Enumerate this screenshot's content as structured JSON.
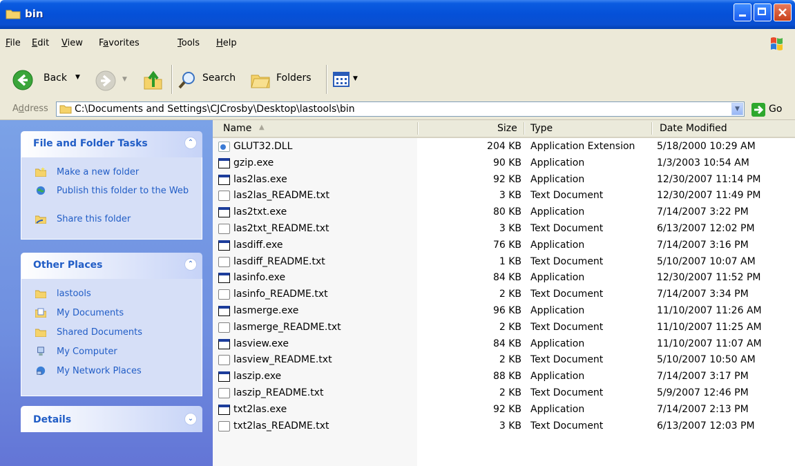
{
  "window": {
    "title": "bin",
    "controls": {
      "minimize": "minimize",
      "maximize": "maximize",
      "close": "close"
    }
  },
  "menu": [
    {
      "label": "File",
      "accel": "F",
      "rest": "ile"
    },
    {
      "label": "Edit",
      "accel": "E",
      "rest": "dit"
    },
    {
      "label": "View",
      "accel": "V",
      "rest": "iew"
    },
    {
      "label": "Favorites",
      "accel": "a",
      "pre": "F",
      "rest": "vorites"
    },
    {
      "label": "Tools",
      "accel": "T",
      "rest": "ools"
    },
    {
      "label": "Help",
      "accel": "H",
      "rest": "elp"
    }
  ],
  "toolbar": {
    "back": "Back",
    "search": "Search",
    "folders": "Folders"
  },
  "address": {
    "label_pre": "A",
    "label_accel": "d",
    "label_rest": "dress",
    "path": "C:\\Documents and Settings\\CJCrosby\\Desktop\\lastools\\bin",
    "go": "Go"
  },
  "sidebar": {
    "file_tasks": {
      "title": "File and Folder Tasks",
      "items": [
        {
          "label": "Make a new folder",
          "icon": "new-folder-icon"
        },
        {
          "label": "Publish this folder to the Web",
          "icon": "publish-web-icon"
        },
        {
          "label": "Share this folder",
          "icon": "share-folder-icon"
        }
      ]
    },
    "other_places": {
      "title": "Other Places",
      "items": [
        {
          "label": "lastools",
          "icon": "folder-icon"
        },
        {
          "label": "My Documents",
          "icon": "my-documents-icon"
        },
        {
          "label": "Shared Documents",
          "icon": "folder-icon"
        },
        {
          "label": "My Computer",
          "icon": "my-computer-icon"
        },
        {
          "label": "My Network Places",
          "icon": "network-places-icon"
        }
      ]
    },
    "details": {
      "title": "Details"
    }
  },
  "columns": {
    "name": "Name",
    "size": "Size",
    "type": "Type",
    "date": "Date Modified"
  },
  "files": [
    {
      "name": "GLUT32.DLL",
      "size": "204 KB",
      "type": "Application Extension",
      "date": "5/18/2000 10:29 AM",
      "kind": "dll"
    },
    {
      "name": "gzip.exe",
      "size": "90 KB",
      "type": "Application",
      "date": "1/3/2003 10:54 AM",
      "kind": "app"
    },
    {
      "name": "las2las.exe",
      "size": "92 KB",
      "type": "Application",
      "date": "12/30/2007 11:14 PM",
      "kind": "app"
    },
    {
      "name": "las2las_README.txt",
      "size": "3 KB",
      "type": "Text Document",
      "date": "12/30/2007 11:49 PM",
      "kind": "txt"
    },
    {
      "name": "las2txt.exe",
      "size": "80 KB",
      "type": "Application",
      "date": "7/14/2007 3:22 PM",
      "kind": "app"
    },
    {
      "name": "las2txt_README.txt",
      "size": "3 KB",
      "type": "Text Document",
      "date": "6/13/2007 12:02 PM",
      "kind": "txt"
    },
    {
      "name": "lasdiff.exe",
      "size": "76 KB",
      "type": "Application",
      "date": "7/14/2007 3:16 PM",
      "kind": "app"
    },
    {
      "name": "lasdiff_README.txt",
      "size": "1 KB",
      "type": "Text Document",
      "date": "5/10/2007 10:07 AM",
      "kind": "txt"
    },
    {
      "name": "lasinfo.exe",
      "size": "84 KB",
      "type": "Application",
      "date": "12/30/2007 11:52 PM",
      "kind": "app"
    },
    {
      "name": "lasinfo_README.txt",
      "size": "2 KB",
      "type": "Text Document",
      "date": "7/14/2007 3:34 PM",
      "kind": "txt"
    },
    {
      "name": "lasmerge.exe",
      "size": "96 KB",
      "type": "Application",
      "date": "11/10/2007 11:26 AM",
      "kind": "app"
    },
    {
      "name": "lasmerge_README.txt",
      "size": "2 KB",
      "type": "Text Document",
      "date": "11/10/2007 11:25 AM",
      "kind": "txt"
    },
    {
      "name": "lasview.exe",
      "size": "84 KB",
      "type": "Application",
      "date": "11/10/2007 11:07 AM",
      "kind": "app"
    },
    {
      "name": "lasview_README.txt",
      "size": "2 KB",
      "type": "Text Document",
      "date": "5/10/2007 10:50 AM",
      "kind": "txt"
    },
    {
      "name": "laszip.exe",
      "size": "88 KB",
      "type": "Application",
      "date": "7/14/2007 3:17 PM",
      "kind": "app"
    },
    {
      "name": "laszip_README.txt",
      "size": "2 KB",
      "type": "Text Document",
      "date": "5/9/2007 12:46 PM",
      "kind": "txt"
    },
    {
      "name": "txt2las.exe",
      "size": "92 KB",
      "type": "Application",
      "date": "7/14/2007 2:13 PM",
      "kind": "app"
    },
    {
      "name": "txt2las_README.txt",
      "size": "3 KB",
      "type": "Text Document",
      "date": "6/13/2007 12:03 PM",
      "kind": "txt"
    }
  ]
}
